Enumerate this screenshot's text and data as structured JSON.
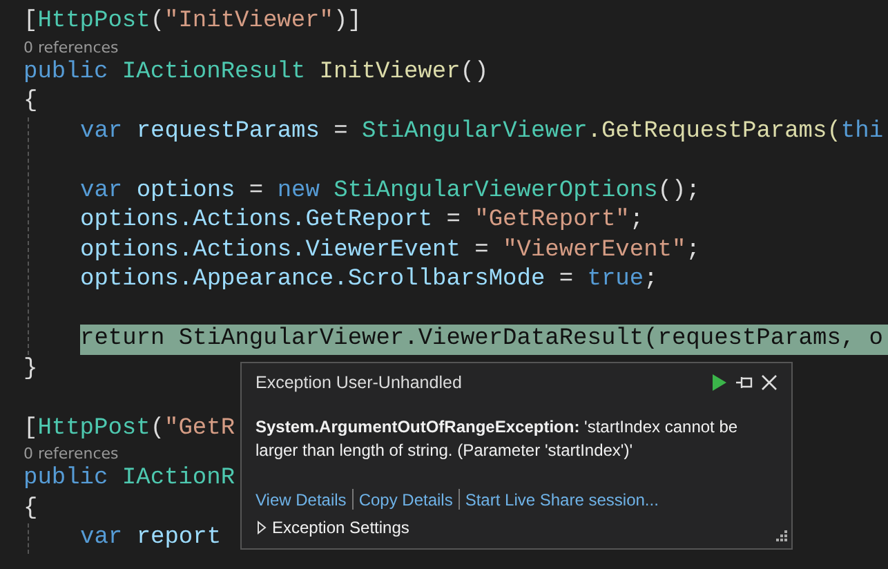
{
  "editor": {
    "lines": [
      {
        "kind": "code",
        "highlighted": false,
        "tokens": [
          {
            "text": "[",
            "kind": "plain"
          },
          {
            "text": "HttpPost",
            "kind": "type"
          },
          {
            "text": "(",
            "kind": "plain"
          },
          {
            "text": "\"InitViewer\"",
            "kind": "string"
          },
          {
            "text": ")]",
            "kind": "plain"
          }
        ]
      },
      {
        "kind": "codelens",
        "text": "0 references"
      },
      {
        "kind": "code",
        "highlighted": false,
        "tokens": [
          {
            "text": "public ",
            "kind": "keyword"
          },
          {
            "text": "IActionResult ",
            "kind": "type"
          },
          {
            "text": "InitViewer",
            "kind": "method"
          },
          {
            "text": "()",
            "kind": "plain"
          }
        ]
      },
      {
        "kind": "code",
        "highlighted": false,
        "tokens": [
          {
            "text": "{",
            "kind": "plain"
          }
        ],
        "children": [
          {
            "kind": "code",
            "highlighted": false,
            "tokens": [
              {
                "text": "var ",
                "kind": "keyword"
              },
              {
                "text": "requestParams",
                "kind": "ident"
              },
              {
                "text": " = ",
                "kind": "plain"
              },
              {
                "text": "StiAngularViewer",
                "kind": "type"
              },
              {
                "text": ".GetRequestParams(",
                "kind": "method"
              },
              {
                "text": "thi",
                "kind": "keyword"
              }
            ]
          },
          {
            "kind": "blank"
          },
          {
            "kind": "code",
            "highlighted": false,
            "tokens": [
              {
                "text": "var ",
                "kind": "keyword"
              },
              {
                "text": "options",
                "kind": "ident"
              },
              {
                "text": " = ",
                "kind": "plain"
              },
              {
                "text": "new ",
                "kind": "keyword"
              },
              {
                "text": "StiAngularViewerOptions",
                "kind": "type"
              },
              {
                "text": "();",
                "kind": "plain"
              }
            ]
          },
          {
            "kind": "code",
            "highlighted": false,
            "tokens": [
              {
                "text": "options.Actions.GetReport",
                "kind": "ident"
              },
              {
                "text": " = ",
                "kind": "plain"
              },
              {
                "text": "\"GetReport\"",
                "kind": "string"
              },
              {
                "text": ";",
                "kind": "plain"
              }
            ]
          },
          {
            "kind": "code",
            "highlighted": false,
            "tokens": [
              {
                "text": "options.Actions.ViewerEvent",
                "kind": "ident"
              },
              {
                "text": " = ",
                "kind": "plain"
              },
              {
                "text": "\"ViewerEvent\"",
                "kind": "string"
              },
              {
                "text": ";",
                "kind": "plain"
              }
            ]
          },
          {
            "kind": "code",
            "highlighted": false,
            "tokens": [
              {
                "text": "options.Appearance.ScrollbarsMode",
                "kind": "ident"
              },
              {
                "text": " = ",
                "kind": "plain"
              },
              {
                "text": "true",
                "kind": "keyword"
              },
              {
                "text": ";",
                "kind": "plain"
              }
            ]
          },
          {
            "kind": "blank"
          },
          {
            "kind": "code",
            "highlighted": true,
            "tokens": [
              {
                "text": "return StiAngularViewer.ViewerDataResult(requestParams, o",
                "kind": "plain"
              }
            ]
          }
        ]
      },
      {
        "kind": "code",
        "highlighted": false,
        "tokens": [
          {
            "text": "}",
            "kind": "plain"
          }
        ]
      },
      {
        "kind": "blank"
      },
      {
        "kind": "code",
        "highlighted": false,
        "tokens": [
          {
            "text": "[",
            "kind": "plain"
          },
          {
            "text": "HttpPost",
            "kind": "type"
          },
          {
            "text": "(",
            "kind": "plain"
          },
          {
            "text": "\"GetR",
            "kind": "string"
          }
        ]
      },
      {
        "kind": "codelens",
        "text": "0 references"
      },
      {
        "kind": "code",
        "highlighted": false,
        "tokens": [
          {
            "text": "public ",
            "kind": "keyword"
          },
          {
            "text": "IActionR",
            "kind": "type"
          }
        ]
      },
      {
        "kind": "code",
        "highlighted": false,
        "tokens": [
          {
            "text": "{",
            "kind": "plain"
          }
        ],
        "children": [
          {
            "kind": "code",
            "highlighted": false,
            "tokens": [
              {
                "text": "var ",
                "kind": "keyword"
              },
              {
                "text": "report",
                "kind": "ident"
              }
            ]
          }
        ]
      }
    ]
  },
  "exception_popup": {
    "title": "Exception User-Unhandled",
    "message": "**System.ArgumentOutOfRangeException:** 'startIndex cannot be larger than length of string. (Parameter 'startIndex')'",
    "links": [
      "View Details",
      "Copy Details",
      "Start Live Share session..."
    ],
    "settings": {
      "label": "Exception Settings",
      "expanded": false
    }
  }
}
